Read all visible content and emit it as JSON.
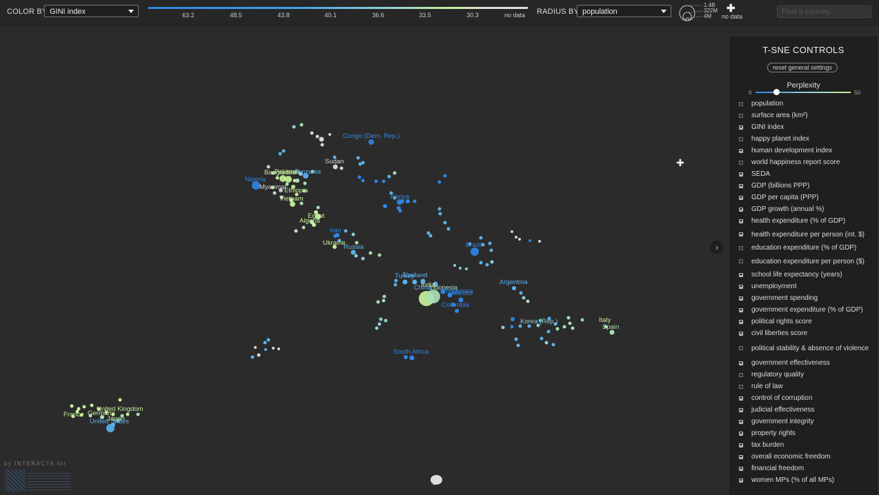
{
  "toolbar": {
    "color_by_label": "COLOR BY",
    "color_by_value": "GINI index",
    "radius_by_label": "RADIUS BY",
    "radius_by_value": "population",
    "legend_ticks": [
      "63.2",
      "48.5",
      "43.8",
      "40.1",
      "36.6",
      "33.5",
      "30.3",
      "no data"
    ],
    "size_legend": [
      "1.4B",
      "322M",
      "4M"
    ],
    "size_no_data": "no data",
    "add_icon": "plus-icon",
    "search_placeholder": "Find a country..."
  },
  "panel": {
    "title": "T-SNE CONTROLS",
    "reset_label": "reset general settings",
    "perplexity_label": "Perplexity",
    "perplexity_min": "0",
    "perplexity_max": "50",
    "perplexity_value": 11,
    "features": [
      {
        "label": "population",
        "checked": false
      },
      {
        "label": "surface area (km²)",
        "checked": false
      },
      {
        "label": "GINI index",
        "checked": true
      },
      {
        "label": "happy planet index",
        "checked": false
      },
      {
        "label": "human development index",
        "checked": true
      },
      {
        "label": "world happiness report score",
        "checked": false
      },
      {
        "label": "SEDA",
        "checked": true
      },
      {
        "label": "GDP (billions PPP)",
        "checked": true
      },
      {
        "label": "GDP per capita (PPP)",
        "checked": true
      },
      {
        "label": "GDP growth (annual %)",
        "checked": true
      },
      {
        "label": "health expenditure (% of GDP)",
        "checked": true
      },
      {
        "label": "health expenditure per person (int. $)",
        "checked": true
      },
      {
        "label": "education expenditure (% of GDP)",
        "checked": false
      },
      {
        "label": "education expenditure per person ($)",
        "checked": false
      },
      {
        "label": "school life expectancy (years)",
        "checked": true
      },
      {
        "label": "unemployment",
        "checked": true
      },
      {
        "label": "government spending",
        "checked": true
      },
      {
        "label": "government expenditure (% of GDP)",
        "checked": true
      },
      {
        "label": "political rights score",
        "checked": true
      },
      {
        "label": "civil liberties score",
        "checked": true
      },
      {
        "label": "political stability & absence of violence",
        "checked": false
      },
      {
        "label": "government effectiveness",
        "checked": true
      },
      {
        "label": "regulatory quality",
        "checked": false
      },
      {
        "label": "rule of law",
        "checked": false
      },
      {
        "label": "control of corruption",
        "checked": true
      },
      {
        "label": "judicial effectiveness",
        "checked": true
      },
      {
        "label": "government integrity",
        "checked": true
      },
      {
        "label": "property rights",
        "checked": true
      },
      {
        "label": "tax burden",
        "checked": true
      },
      {
        "label": "overall economic freedom",
        "checked": true
      },
      {
        "label": "financial freedom",
        "checked": true
      },
      {
        "label": "women MPs (% of all MPs)",
        "checked": true
      }
    ]
  },
  "branding": {
    "by_line": "by INTERACTA for"
  },
  "colors": {
    "blue": "#2f86e6",
    "lightblue": "#5bb3f0",
    "cyan": "#8fd0d8",
    "green": "#c7f09a",
    "nodata": "#d6d6d6",
    "lightgreen": "#a8e0b5"
  },
  "countries": [
    {
      "name": "Congo (Dem. Rep.)",
      "color": "blue"
    },
    {
      "name": "Sudan",
      "color": "nodata"
    },
    {
      "name": "Bangladesh",
      "color": "green"
    },
    {
      "name": "Pakistan",
      "color": "green"
    },
    {
      "name": "Tanzania",
      "color": "lightblue"
    },
    {
      "name": "Nigeria",
      "color": "blue"
    },
    {
      "name": "Myanmar",
      "color": "nodata"
    },
    {
      "name": "Ethiopia",
      "color": "green"
    },
    {
      "name": "Vietnam",
      "color": "green"
    },
    {
      "name": "Kenya",
      "color": "blue"
    },
    {
      "name": "Egypt",
      "color": "green"
    },
    {
      "name": "Algeria",
      "color": "green"
    },
    {
      "name": "Iran",
      "color": "blue"
    },
    {
      "name": "Ukraine",
      "color": "green"
    },
    {
      "name": "Russia",
      "color": "lightblue"
    },
    {
      "name": "Brazil",
      "color": "blue"
    },
    {
      "name": "Turkey",
      "color": "lightblue"
    },
    {
      "name": "Thailand",
      "color": "lightblue"
    },
    {
      "name": "India",
      "color": "green"
    },
    {
      "name": "Indonesia",
      "color": "lightgreen"
    },
    {
      "name": "China",
      "color": "lightblue"
    },
    {
      "name": "Philippines",
      "color": "blue"
    },
    {
      "name": "Mexico",
      "color": "blue"
    },
    {
      "name": "Colombia",
      "color": "blue"
    },
    {
      "name": "Argentina",
      "color": "lightblue"
    },
    {
      "name": "Korea (Rep.)",
      "color": "cyan"
    },
    {
      "name": "Italy",
      "color": "green"
    },
    {
      "name": "Spain",
      "color": "lightgreen"
    },
    {
      "name": "South Africa",
      "color": "blue"
    },
    {
      "name": "United Kingdom",
      "color": "green"
    },
    {
      "name": "France",
      "color": "green"
    },
    {
      "name": "Germany",
      "color": "green"
    },
    {
      "name": "Japan",
      "color": "green"
    },
    {
      "name": "United States",
      "color": "lightblue"
    }
  ]
}
